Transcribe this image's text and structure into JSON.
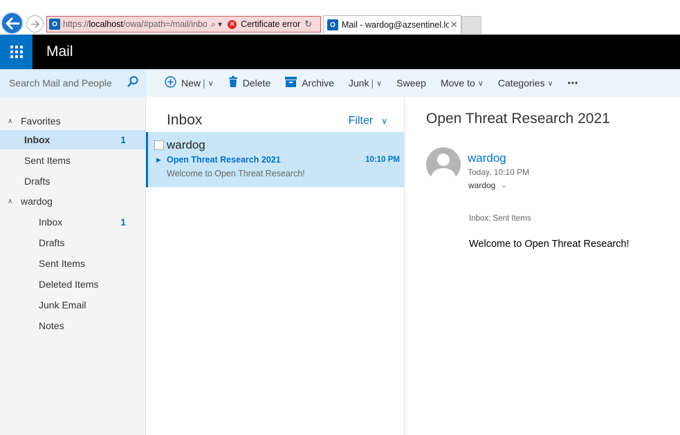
{
  "browser": {
    "url_prefix": "https://",
    "url_host": "localhost",
    "url_path": "/owa/#path=/mail/inbox",
    "search_glyph": "⌕ ▾",
    "cert_error": "Certificate error",
    "tab_title": "Mail - wardog@azsentinel.local"
  },
  "header": {
    "app_name": "Mail"
  },
  "search": {
    "placeholder": "Search Mail and People"
  },
  "toolbar": {
    "new_label": "New",
    "delete_label": "Delete",
    "archive_label": "Archive",
    "junk_label": "Junk",
    "sweep_label": "Sweep",
    "moveto_label": "Move to",
    "categories_label": "Categories",
    "more_label": "•••"
  },
  "folders": {
    "favorites_label": "Favorites",
    "fav_inbox": "Inbox",
    "fav_inbox_count": "1",
    "fav_sent": "Sent Items",
    "fav_drafts": "Drafts",
    "account_label": "wardog",
    "acc_inbox": "Inbox",
    "acc_inbox_count": "1",
    "acc_drafts": "Drafts",
    "acc_sent": "Sent Items",
    "acc_deleted": "Deleted Items",
    "acc_junk": "Junk Email",
    "acc_notes": "Notes"
  },
  "list": {
    "title": "Inbox",
    "filter_label": "Filter",
    "message": {
      "from": "wardog",
      "subject": "Open Threat Research 2021",
      "time": "10:10 PM",
      "preview": "Welcome to Open Threat Research!"
    }
  },
  "reading": {
    "subject": "Open Threat Research 2021",
    "from": "wardog",
    "date": "Today, 10:10 PM",
    "to": "wardog",
    "folders": "Inbox; Sent Items",
    "body": "Welcome to Open Threat Research!"
  },
  "colors": {
    "accent": "#0072c6",
    "selected_bg": "#cde6f7",
    "header_bg": "#000000"
  }
}
